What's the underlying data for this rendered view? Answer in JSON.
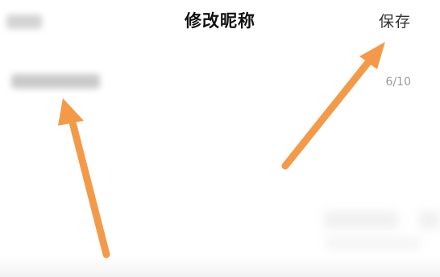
{
  "header": {
    "title": "修改昵称",
    "save_label": "保存"
  },
  "nickname": {
    "counter": "6/10"
  },
  "annotations": {
    "arrow_color": "#F39A4A"
  }
}
